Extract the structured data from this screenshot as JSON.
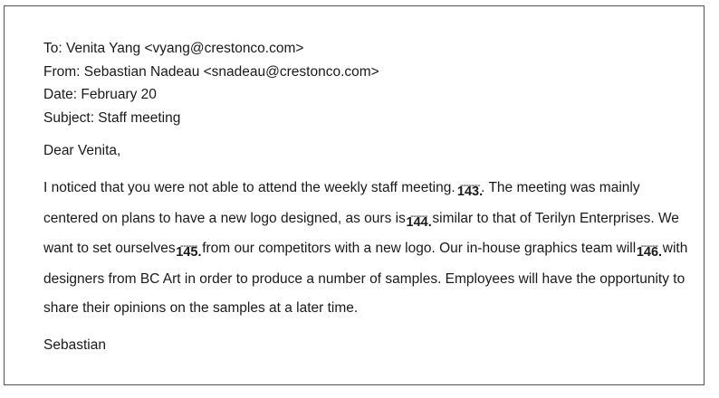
{
  "email": {
    "to": "To: Venita Yang <vyang@crestonco.com>",
    "from": "From: Sebastian Nadeau <snadeau@crestonco.com>",
    "date": "Date: February 20",
    "subject": "Subject: Staff meeting"
  },
  "greeting": "Dear Venita,",
  "blanks": {
    "b143": {
      "dashes": "-------",
      "number": "143."
    },
    "b144": {
      "dashes": "------",
      "number": "144."
    },
    "b145": {
      "dashes": "------",
      "number": "145."
    },
    "b146": {
      "dashes": "------",
      "number": "146."
    }
  },
  "body": {
    "seg1": "I noticed that you were not able to attend the weekly staff meeting. ",
    "seg2": ". The meeting was mainly centered on plans to have a new logo designed, as ours is ",
    "seg3": " similar to that of Terilyn Enterprises. We want to set ourselves ",
    "seg4": " from our competitors with a new logo. Our in-house graphics team will ",
    "seg5": " with designers from BC Art in order to produce a number of samples. Employees will have the opportunity to share their opinions on the samples at a later time."
  },
  "signature": "Sebastian"
}
